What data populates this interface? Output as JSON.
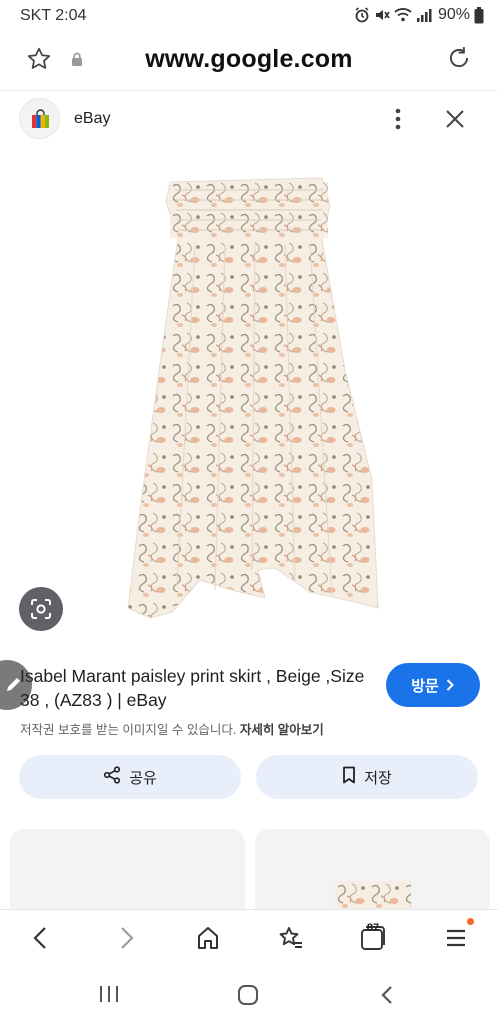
{
  "status_bar": {
    "time": "SKT 2:04",
    "battery": "90%",
    "icons": [
      "alarm-icon",
      "mute-icon",
      "wifi-icon",
      "signal-icon",
      "battery-icon"
    ]
  },
  "url_bar": {
    "url": "www.google.com",
    "icons": [
      "bookmark-star-icon",
      "lock-icon",
      "reload-icon"
    ]
  },
  "source": {
    "name": "eBay",
    "icons": [
      "ebay-bag-icon",
      "more-vert-icon",
      "close-icon"
    ]
  },
  "product": {
    "image_alt": "Isabel Marant paisley print skirt",
    "title": "Isabel Marant paisley print skirt , Beige ,Size 38 , (AZ83 ) | eBay",
    "visit_label": "방문",
    "copyright_text": "저작권 보호를 받는 이미지일 수 있습니다.",
    "learn_more_label": "자세히 알아보기"
  },
  "actions": {
    "share_label": "공유",
    "save_label": "저장"
  },
  "toolbar": {
    "tab_count": "87",
    "icons": [
      "back-icon",
      "forward-icon",
      "home-icon",
      "bookmarks-icon",
      "tabs-icon",
      "menu-icon"
    ]
  },
  "system_nav": {
    "icons": [
      "recent-apps-icon",
      "home-nav-icon",
      "back-nav-icon"
    ]
  },
  "colors": {
    "accent": "#1a73e8",
    "chip_bg": "#e8effa",
    "menu_badge": "#f5661e"
  }
}
